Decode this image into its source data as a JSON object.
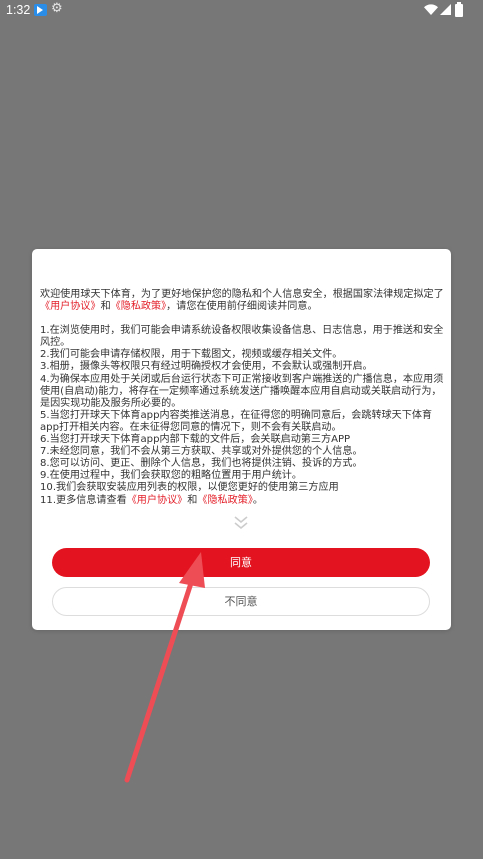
{
  "status_bar": {
    "time": "1:32",
    "icons": [
      "app-notification-icon",
      "gear-icon",
      "wifi-icon",
      "signal-icon",
      "battery-icon"
    ]
  },
  "dialog": {
    "intro_before": "欢迎使用球天下体育，为了更好地保护您的隐私和个人信息安全，根据国家法律规定拟定了",
    "user_agreement_link": "《用户协议》",
    "and": "和",
    "privacy_policy_link": "《隐私政策》",
    "intro_after": "，请您在使用前仔细阅读并同意。",
    "items": [
      "1.在浏览使用时，我们可能会申请系统设备权限收集设备信息、日志信息，用于推送和安全风控。",
      "2.我们可能会申请存储权限，用于下载图文，视频或缓存相关文件。",
      "3.相册，摄像头等权限只有经过明确授权才会使用，不会默认或强制开启。",
      "4.为确保本应用处于关闭或后台运行状态下可正常接收到客户端推送的广播信息，本应用须使用(自启动)能力，将存在一定频率通过系统发送广播唤醒本应用自启动或关联启动行为，是因实现功能及服务所必要的。",
      "5.当您打开球天下体育app内容类推送消息，在征得您的明确同意后，会跳转球天下体育app打开相关内容。在未征得您同意的情况下，则不会有关联启动。",
      "6.当您打开球天下体育app内部下载的文件后，会关联启动第三方APP",
      "7.未经您同意，我们不会从第三方获取、共享或对外提供您的个人信息。",
      "8.您可以访问、更正、删除个人信息，我们也将提供注销、投诉的方式。",
      "9.在使用过程中，我们会获取您的粗略位置用于用户统计。",
      "10.我们会获取安装应用列表的权限，以便您更好的使用第三方应用"
    ],
    "last_item_prefix": "11.更多信息请查看",
    "last_item_link1": "《用户协议》",
    "last_item_and": "和",
    "last_item_link2": "《隐私政策》",
    "last_item_suffix": "。",
    "agree_label": "同意",
    "decline_label": "不同意"
  },
  "colors": {
    "accent": "#e3141f",
    "link": "#e3202a",
    "overlay": "#777777",
    "arrow": "#ee4d55"
  }
}
